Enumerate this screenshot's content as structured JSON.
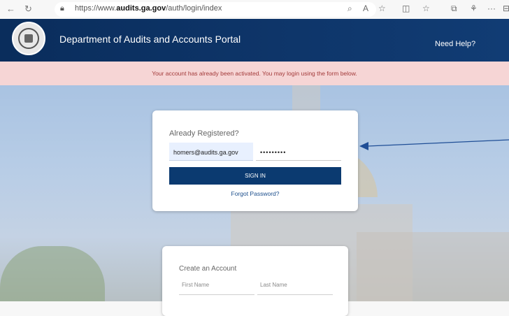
{
  "browser": {
    "back_icon": "back-arrow-icon",
    "reload_icon": "reload-icon",
    "url_host": "https://www.",
    "url_domain": "audits.ga.gov",
    "url_path": "/auth/login/index",
    "toolbar_icons": [
      "search-icon",
      "read-aloud-icon",
      "favorite-icon",
      "split-screen-icon",
      "favorites-list-icon",
      "collections-icon",
      "extensions-icon",
      "more-icon",
      "sidebar-icon"
    ]
  },
  "header": {
    "title": "Department of Audits and Accounts Portal",
    "help_link": "Need Help?",
    "brand_color": "#0a2d5c"
  },
  "alert": {
    "message": "Your account has already been activated. You may login using the form below.",
    "text_color": "#a33a3a",
    "background": "#f6d5d5"
  },
  "login": {
    "heading": "Already Registered?",
    "email_value": "homers@audits.ga.gov",
    "password_value": "•••••••••",
    "signin_label": "SIGN IN",
    "forgot_label": "Forgot Password?"
  },
  "create_account": {
    "heading": "Create an Account",
    "first_name_placeholder": "First Name",
    "last_name_placeholder": "Last Name"
  },
  "annotation": {
    "arrow_color": "#1f4e96"
  }
}
